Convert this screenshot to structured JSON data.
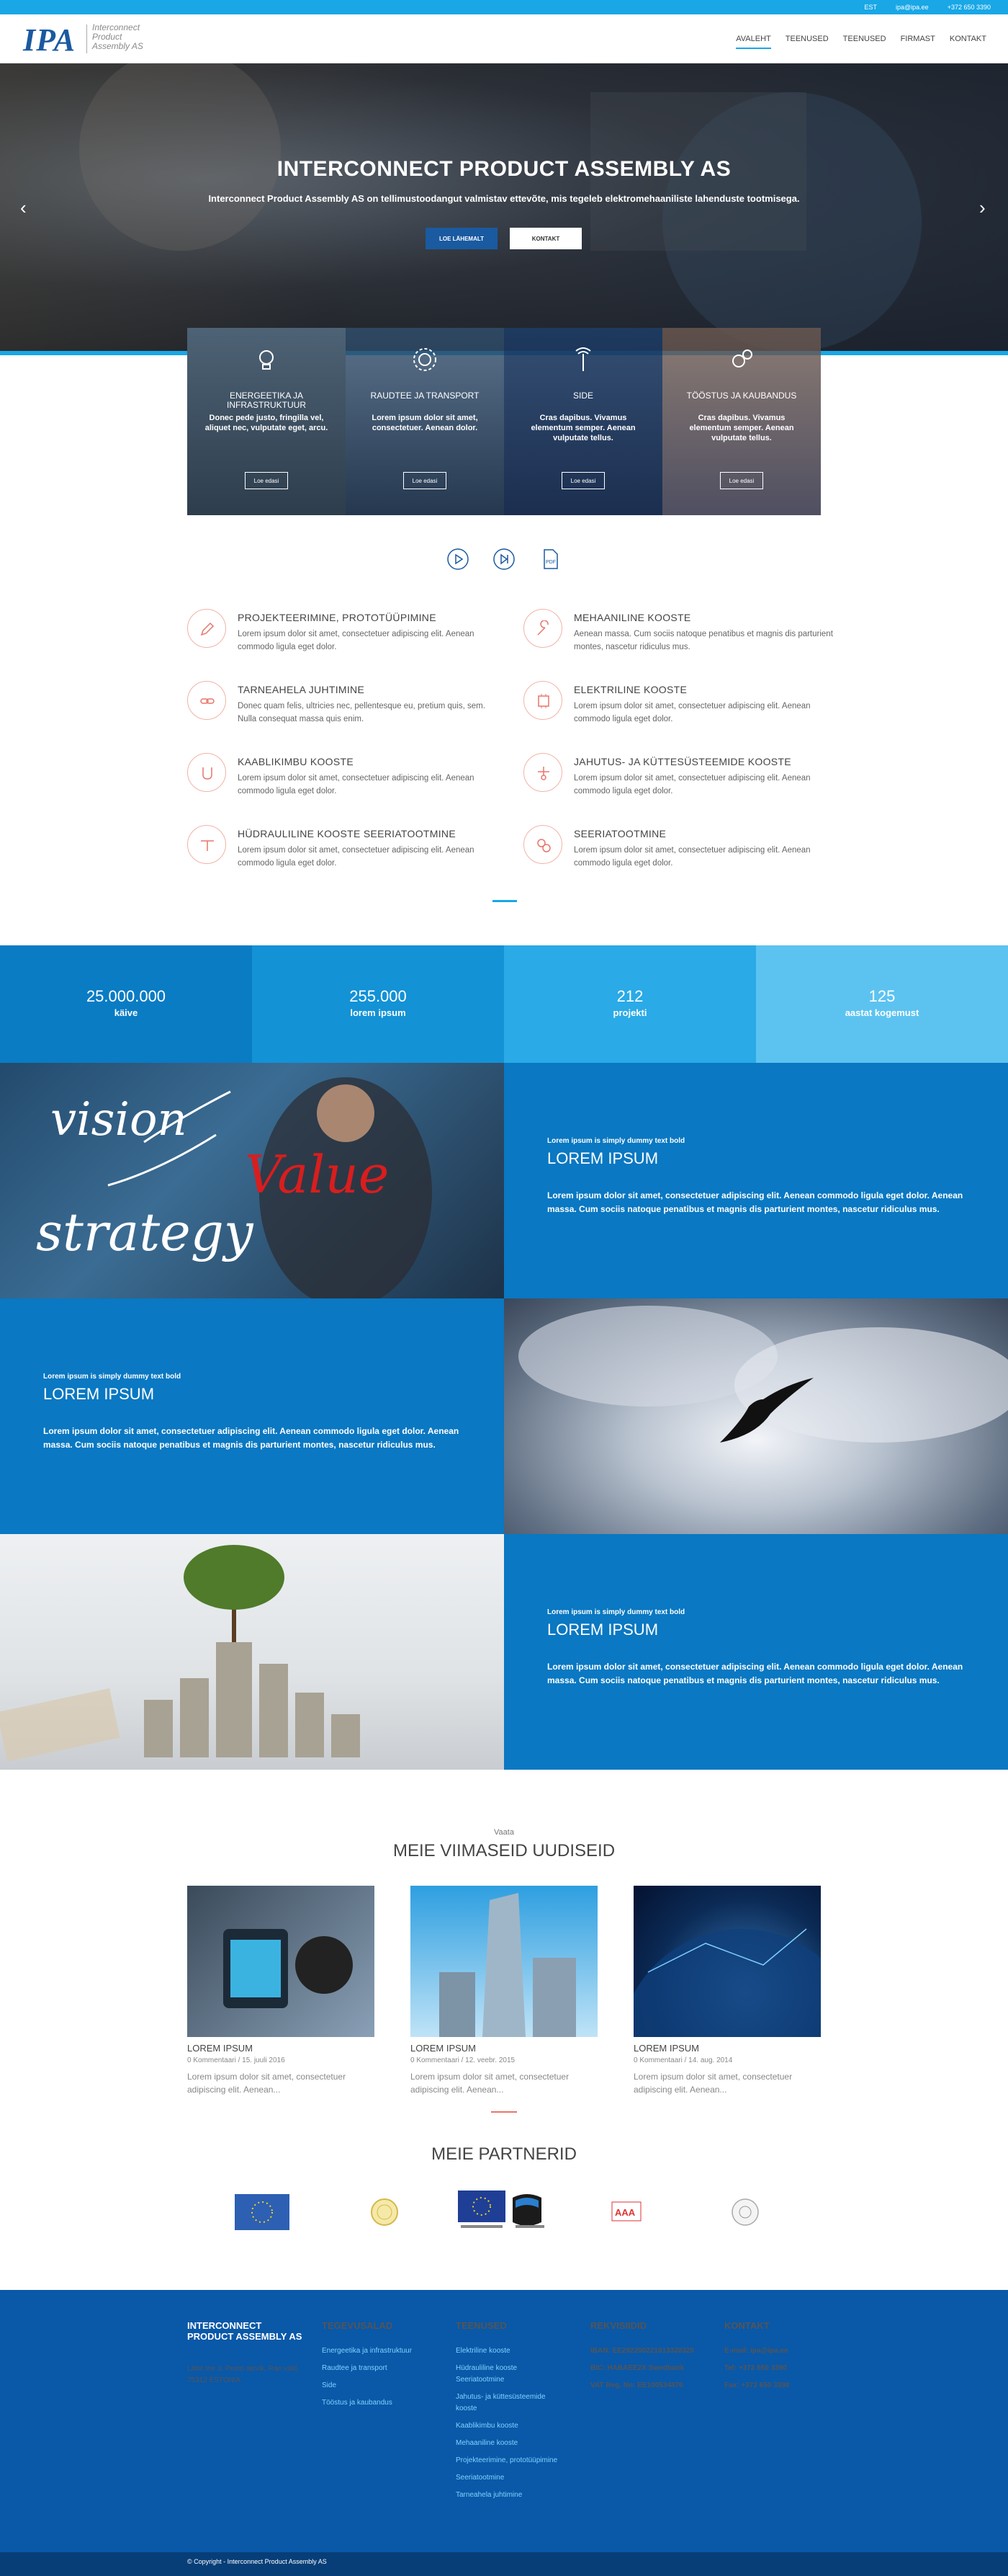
{
  "topbar": {
    "lang": "EST",
    "email": "ipa@ipa.ee",
    "phone": "+372 650 3390"
  },
  "header": {
    "logo_mark": "IPA",
    "logo_text": "Interconnect\nProduct\nAssembly AS",
    "nav": [
      "AVALEHT",
      "TEENUSED",
      "TEENUSED",
      "FIRMAST",
      "KONTAKT"
    ]
  },
  "hero": {
    "title": "INTERCONNECT PRODUCT ASSEMBLY AS",
    "subtitle": "Interconnect Product Assembly AS on tellimustoodangut valmistav ettevõte, mis tegeleb elektromehaaniliste lahenduste tootmisega.",
    "btn_primary": "LOE LÄHEMALT",
    "btn_secondary": "KONTAKT",
    "arrow_left": "‹",
    "arrow_right": "›"
  },
  "cards": [
    {
      "title": "ENERGEETIKA JA INFRASTRUKTUUR",
      "text": "Donec pede justo, fringilla vel, aliquet nec, vulputate eget, arcu.",
      "button": "Loe edasi",
      "bg": "#5f7686"
    },
    {
      "title": "RAUDTEE JA TRANSPORT",
      "text": "Lorem ipsum dolor sit amet, consectetuer. Aenean dolor.",
      "button": "Loe edasi",
      "bg": "#2f4b66"
    },
    {
      "title": "SIDE",
      "text": "Cras dapibus. Vivamus elementum semper. Aenean vulputate tellus.",
      "button": "Loe edasi",
      "bg": "#1c3a63"
    },
    {
      "title": "TÖÖSTUS JA KAUBANDUS",
      "text": "Cras dapibus. Vivamus elementum semper. Aenean vulputate tellus.",
      "button": "Loe edasi",
      "bg": "#5b4d48"
    }
  ],
  "services": [
    {
      "title": "PROJEKTEERIMINE, PROTOTÜÜPIMINE",
      "text": "Lorem ipsum dolor sit amet, consectetuer adipiscing elit. Aenean commodo ligula eget dolor."
    },
    {
      "title": "MEHAANILINE KOOSTE",
      "text": "Aenean massa. Cum sociis natoque penatibus et magnis dis parturient montes, nascetur ridiculus mus."
    },
    {
      "title": "TARNEAHELA JUHTIMINE",
      "text": "Donec quam felis, ultricies nec, pellentesque eu, pretium quis, sem. Nulla consequat massa quis enim."
    },
    {
      "title": "ELEKTRILINE KOOSTE",
      "text": "Lorem ipsum dolor sit amet, consectetuer adipiscing elit. Aenean commodo ligula eget dolor."
    },
    {
      "title": "KAABLIKIMBU KOOSTE",
      "text": "Lorem ipsum dolor sit amet, consectetuer adipiscing elit. Aenean commodo ligula eget dolor."
    },
    {
      "title": "JAHUTUS- JA KÜTTESÜSTEEMIDE KOOSTE",
      "text": "Lorem ipsum dolor sit amet, consectetuer adipiscing elit. Aenean commodo ligula eget dolor."
    },
    {
      "title": "HÜDRAULILINE KOOSTE SEERIATOOTMINE",
      "text": "Lorem ipsum dolor sit amet, consectetuer adipiscing elit. Aenean commodo ligula eget dolor."
    },
    {
      "title": "SEERIATOOTMINE",
      "text": "Lorem ipsum dolor sit amet, consectetuer adipiscing elit. Aenean commodo ligula eget dolor."
    }
  ],
  "stats": [
    {
      "number": "25.000.000",
      "label": "käive",
      "bg": "#0a7cc4"
    },
    {
      "number": "255.000",
      "label": "lorem ipsum",
      "bg": "#1392d6"
    },
    {
      "number": "212",
      "label": "projekti",
      "bg": "#2aaae6"
    },
    {
      "number": "125",
      "label": "aastat kogemust",
      "bg": "#5cc3f0"
    }
  ],
  "features": [
    {
      "kicker": "Lorem ipsum is simply dummy text bold",
      "heading": "LOREM IPSUM",
      "text": "Lorem ipsum dolor sit amet, consectetuer adipiscing elit. Aenean commodo ligula eget dolor. Aenean massa. Cum sociis natoque penatibus et magnis dis parturient montes, nascetur ridiculus mus.",
      "img_words": [
        "vision",
        "Value",
        "strategy"
      ]
    },
    {
      "kicker": "Lorem ipsum is simply dummy text bold",
      "heading": "LOREM IPSUM",
      "text": "Lorem ipsum dolor sit amet, consectetuer adipiscing elit. Aenean commodo ligula eget dolor. Aenean massa. Cum sociis natoque penatibus et magnis dis parturient montes, nascetur ridiculus mus."
    },
    {
      "kicker": "Lorem ipsum is simply dummy text bold",
      "heading": "LOREM IPSUM",
      "text": "Lorem ipsum dolor sit amet, consectetuer adipiscing elit. Aenean commodo ligula eget dolor. Aenean massa. Cum sociis natoque penatibus et magnis dis parturient montes, nascetur ridiculus mus."
    }
  ],
  "news": {
    "kicker": "Vaata",
    "title": "MEIE VIIMASEID UUDISEID",
    "items": [
      {
        "title": "LOREM IPSUM",
        "meta": "0 Kommentaari / 15. juuli 2016",
        "text": "Lorem ipsum dolor sit amet, consectetuer adipiscing elit. Aenean..."
      },
      {
        "title": "LOREM IPSUM",
        "meta": "0 Kommentaari / 12. veebr. 2015",
        "text": "Lorem ipsum dolor sit amet, consectetuer adipiscing elit. Aenean..."
      },
      {
        "title": "LOREM IPSUM",
        "meta": "0 Kommentaari / 14. aug. 2014",
        "text": "Lorem ipsum dolor sit amet, consectetuer adipiscing elit. Aenean..."
      }
    ]
  },
  "partners": {
    "title": "MEIE PARTNERID"
  },
  "footer": {
    "company": {
      "title": "INTERCONNECT PRODUCT ASSEMBLY AS",
      "address": "Lätte tee 3, Peetri alevik, Rae vald, 75312 ESTONIA"
    },
    "tegevusalad": {
      "title": "TEGEVUSALAD",
      "links": [
        "Energeetika ja infrastruktuur",
        "Raudtee ja transport",
        "Side",
        "Tööstus ja kaubandus"
      ]
    },
    "teenused": {
      "title": "TEENUSED",
      "links": [
        "Elektriline kooste",
        "Hüdrauliline kooste Seeriatootmine",
        "Jahutus- ja küttesüsteemide kooste",
        "Kaablikimbu kooste",
        "Mehaaniline kooste",
        "Projekteerimine, prototüüpimine",
        "Seeriatootmine",
        "Tarneahela juhtimine"
      ]
    },
    "rekvisiidid": {
      "title": "REKVISIIDID",
      "lines": [
        "IBAN: EE292200221013328320",
        "BIC: HABAEE2X Swedbank",
        "VAT Reg. No: EE100534876"
      ]
    },
    "kontakt": {
      "title": "KONTAKT",
      "lines": [
        "E-mail: ipa@ipa.ee",
        "Tel: +372 650 3390",
        "Fax: +372 650 3390"
      ]
    },
    "copyright": "© Copyright - Interconnect Product Assembly AS"
  }
}
